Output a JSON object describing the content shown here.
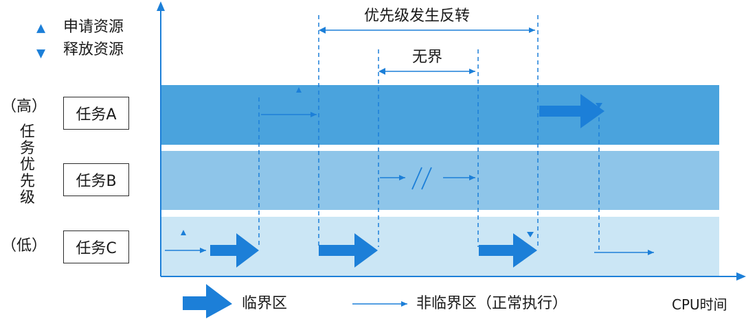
{
  "legend_top": {
    "request_symbol": "▲",
    "request_label": "申请资源",
    "release_symbol": "▼",
    "release_label": "释放资源"
  },
  "priority": {
    "high": "（高）",
    "axis_label": "任务优先级",
    "low": "（低）"
  },
  "tasks": [
    {
      "label": "任务A"
    },
    {
      "label": "任务B"
    },
    {
      "label": "任务C"
    }
  ],
  "spans": {
    "inversion": "优先级发生反转",
    "unbounded": "无界"
  },
  "legend_bottom": {
    "critical": "临界区",
    "non_critical": "非临界区（正常执行）"
  },
  "x_axis_label": "CPU时间",
  "colors": {
    "lane_a": "#4aa3dd",
    "lane_b": "#8ec5e9",
    "lane_c": "#cbe6f5",
    "accent": "#1c7fd8"
  }
}
